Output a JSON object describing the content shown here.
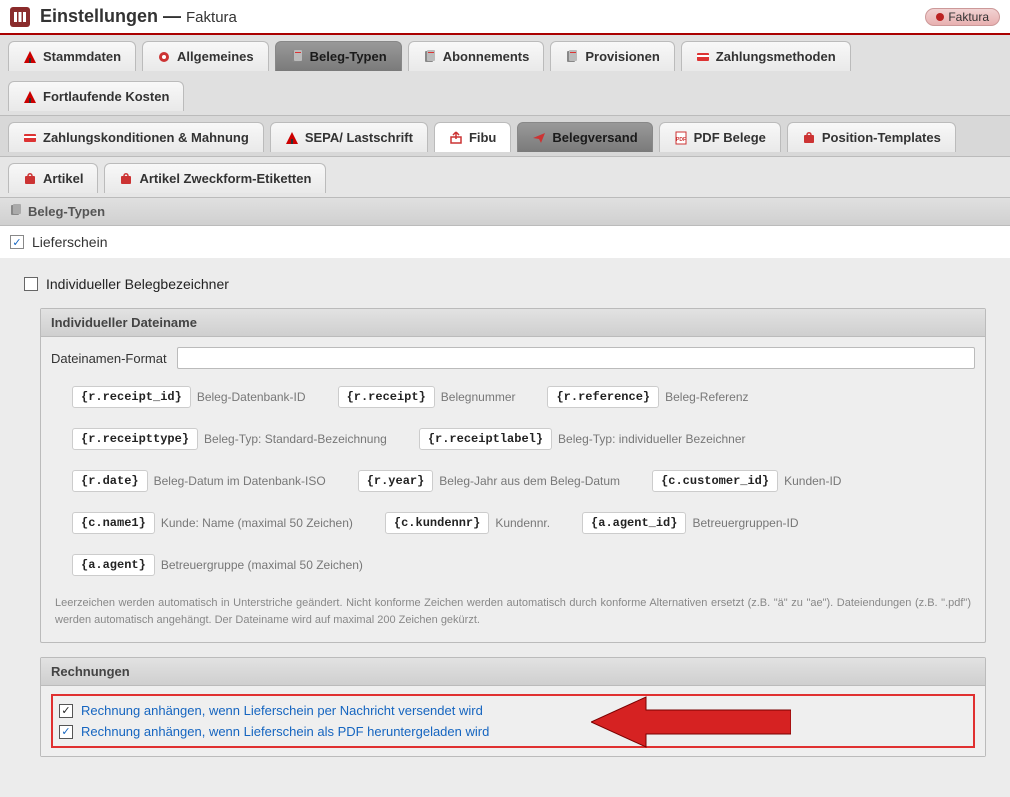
{
  "header": {
    "title": "Einstellungen — ",
    "subtitle": "Faktura",
    "badge": "Faktura"
  },
  "tabs_row1": [
    {
      "icon": "stammdaten",
      "label": "Stammdaten"
    },
    {
      "icon": "gear",
      "label": "Allgemeines"
    },
    {
      "icon": "doc",
      "label": "Beleg-Typen",
      "sel": "dark"
    },
    {
      "icon": "doc",
      "label": "Abonnements"
    },
    {
      "icon": "doc",
      "label": "Provisionen"
    },
    {
      "icon": "card",
      "label": "Zahlungsmethoden"
    },
    {
      "icon": "stammdaten",
      "label": "Fortlaufende Kosten"
    }
  ],
  "tabs_row2": [
    {
      "icon": "card",
      "label": "Zahlungskonditionen & Mahnung"
    },
    {
      "icon": "stammdaten",
      "label": "SEPA/ Lastschrift"
    },
    {
      "icon": "export",
      "label": "Fibu",
      "sel": "white"
    },
    {
      "icon": "send",
      "label": "Belegversand",
      "sel": "dark"
    },
    {
      "icon": "pdf",
      "label": "PDF Belege"
    },
    {
      "icon": "bag",
      "label": "Position-Templates"
    }
  ],
  "tabs_row3": [
    {
      "icon": "bag",
      "label": "Artikel"
    },
    {
      "icon": "bag",
      "label": "Artikel Zweckform-Etiketten"
    }
  ],
  "section_title": "Beleg-Typen",
  "item_title": "Lieferschein",
  "indiv_bezeichner": "Individueller Belegbezeichner",
  "panel1": {
    "title": "Individueller Dateiname",
    "field_label": "Dateinamen-Format",
    "tokens": [
      {
        "code": "{r.receipt_id}",
        "desc": "Beleg-Datenbank-ID"
      },
      {
        "code": "{r.receipt}",
        "desc": "Belegnummer"
      },
      {
        "code": "{r.reference}",
        "desc": "Beleg-Referenz"
      },
      {
        "code": "{r.receipttype}",
        "desc": "Beleg-Typ: Standard-Bezeichnung"
      },
      {
        "code": "{r.receiptlabel}",
        "desc": "Beleg-Typ: individueller Bezeichner"
      },
      {
        "code": "{r.date}",
        "desc": "Beleg-Datum im Datenbank-ISO"
      },
      {
        "code": "{r.year}",
        "desc": "Beleg-Jahr aus dem Beleg-Datum"
      },
      {
        "code": "{c.customer_id}",
        "desc": "Kunden-ID"
      },
      {
        "code": "{c.name1}",
        "desc": "Kunde: Name (maximal 50 Zeichen)"
      },
      {
        "code": "{c.kundennr}",
        "desc": "Kundennr."
      },
      {
        "code": "{a.agent_id}",
        "desc": "Betreuergruppen-ID"
      },
      {
        "code": "{a.agent}",
        "desc": "Betreuergruppe (maximal 50 Zeichen)"
      }
    ],
    "hint": "Leerzeichen werden automatisch in Unterstriche geändert. Nicht konforme Zeichen werden automatisch durch konforme Alternativen ersetzt (z.B. \"ä\" zu \"ae\"). Dateiendungen (z.B. \".pdf\") werden automatisch angehängt. Der Dateiname wird auf maximal 200 Zeichen gekürzt."
  },
  "panel2": {
    "title": "Rechnungen",
    "opt1": "Rechnung anhängen, wenn Lieferschein per Nachricht versendet wird",
    "opt2": "Rechnung anhängen, wenn Lieferschein als PDF heruntergeladen wird"
  }
}
